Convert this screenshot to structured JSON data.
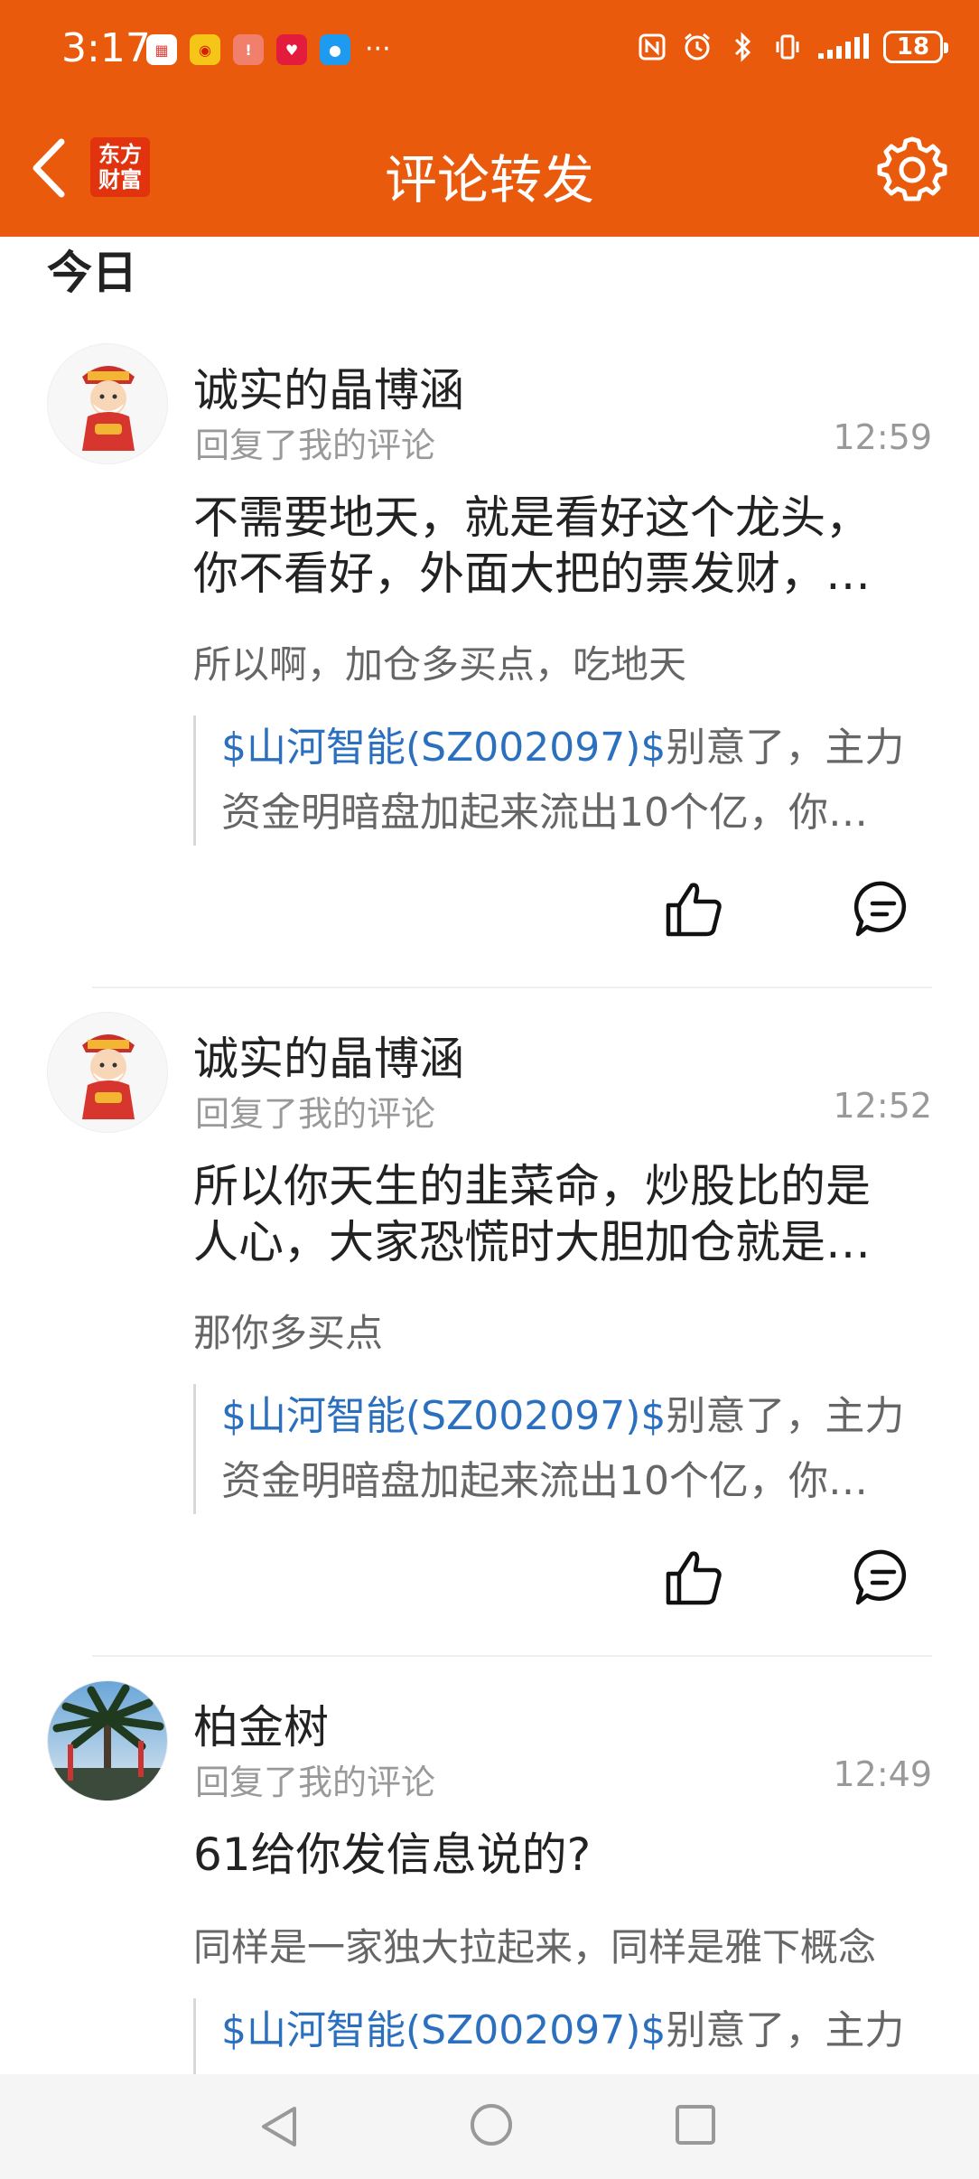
{
  "status_bar": {
    "time": "3:17",
    "battery": "18",
    "app_icons": [
      "huawei-app-icon",
      "weibo-icon",
      "notification-app-icon",
      "heart-app-icon",
      "message-app-icon"
    ],
    "more": "···"
  },
  "header": {
    "title": "评论转发",
    "logo_line1": "东方",
    "logo_line2": "财富"
  },
  "section_date": "今日",
  "comments": [
    {
      "username": "诚实的晶博涵",
      "action": "回复了我的评论",
      "time": "12:59",
      "text_line1": "不需要地天，就是看好这个龙头，",
      "text_line2": "你不看好，外面大把的票发财，…",
      "reply": "所以啊，加仓多买点，吃地天",
      "quote_stock": "$山河智能(SZ002097)$",
      "quote_rest": "别意了，主力",
      "quote_line2": "资金明暗盘加起来流出10个亿，你…"
    },
    {
      "username": "诚实的晶博涵",
      "action": "回复了我的评论",
      "time": "12:52",
      "text_line1": "所以你天生的韭菜命，炒股比的是",
      "text_line2": "人心，大家恐慌时大胆加仓就是…",
      "reply": "那你多买点",
      "quote_stock": "$山河智能(SZ002097)$",
      "quote_rest": "别意了，主力",
      "quote_line2": "资金明暗盘加起来流出10个亿，你…"
    },
    {
      "username": "柏金树",
      "action": "回复了我的评论",
      "time": "12:49",
      "text_line1": "61给你发信息说的?",
      "reply": "同样是一家独大拉起来，同样是雅下概念",
      "quote_stock": "$山河智能(SZ002097)$",
      "quote_rest": "别意了，主力"
    }
  ]
}
